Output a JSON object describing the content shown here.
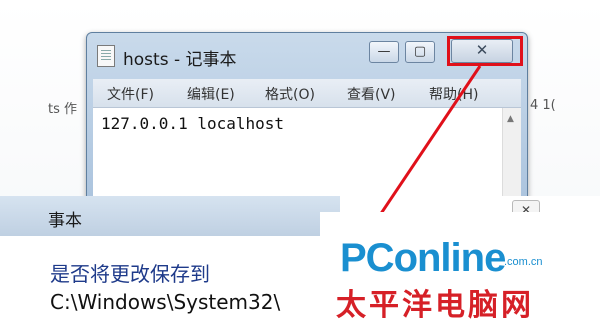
{
  "background": {
    "left_text": "ts  作",
    "right_text": "4 1("
  },
  "notepad": {
    "title": "hosts - 记事本",
    "buttons": {
      "minimize": "—",
      "maximize": "▢",
      "close": "✕"
    },
    "menu": [
      "文件(F)",
      "编辑(E)",
      "格式(O)",
      "查看(V)",
      "帮助(H)"
    ],
    "content": "127.0.0.1 localhost"
  },
  "dialog": {
    "title": "事本",
    "close": "✕",
    "line1": "是否将更改保存到",
    "line2": "C:\\Windows\\System32\\"
  },
  "watermark": {
    "brand": "PConline",
    "domain": ".com.cn",
    "chinese": "太平洋电脑网"
  },
  "colors": {
    "highlight": "#e0101a",
    "brand_blue": "#1a8fd0",
    "brand_red": "#d62027"
  }
}
